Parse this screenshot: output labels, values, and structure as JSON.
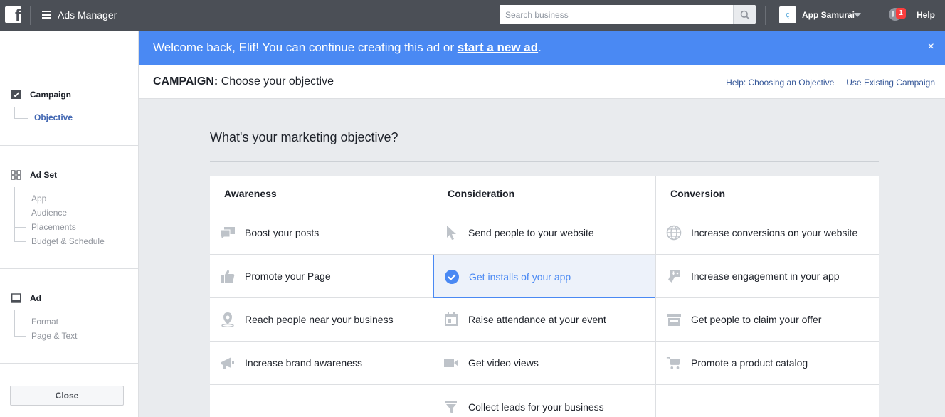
{
  "topbar": {
    "title": "Ads Manager",
    "search_placeholder": "Search business",
    "account_name": "App Samurai",
    "account_initial": "ç",
    "notification_count": "1",
    "help_label": "Help"
  },
  "banner": {
    "text_before": "Welcome back, Elif! You can continue creating this ad or ",
    "link": "start a new ad",
    "text_after": ".",
    "close": "×"
  },
  "campaign_header": {
    "label": "CAMPAIGN:",
    "title": " Choose your objective",
    "help_link": "Help: Choosing an Objective",
    "existing_link": "Use Existing Campaign"
  },
  "sidebar": {
    "campaign": {
      "label": "Campaign",
      "items": [
        "Objective"
      ]
    },
    "ad_set": {
      "label": "Ad Set",
      "items": [
        "App",
        "Audience",
        "Placements",
        "Budget & Schedule"
      ]
    },
    "ad": {
      "label": "Ad",
      "items": [
        "Format",
        "Page & Text"
      ]
    },
    "close_label": "Close"
  },
  "main": {
    "question": "What's your marketing objective?",
    "columns": [
      {
        "title": "Awareness",
        "items": [
          {
            "label": "Boost your posts",
            "icon": "speech-bubbles-icon"
          },
          {
            "label": "Promote your Page",
            "icon": "thumbs-up-icon"
          },
          {
            "label": "Reach people near your business",
            "icon": "map-pin-icon"
          },
          {
            "label": "Increase brand awareness",
            "icon": "megaphone-icon"
          }
        ]
      },
      {
        "title": "Consideration",
        "items": [
          {
            "label": "Send people to your website",
            "icon": "cursor-icon"
          },
          {
            "label": "Get installs of your app",
            "icon": "checkmark-icon",
            "selected": true
          },
          {
            "label": "Raise attendance at your event",
            "icon": "calendar-icon"
          },
          {
            "label": "Get video views",
            "icon": "video-camera-icon"
          },
          {
            "label": "Collect leads for your business",
            "icon": "funnel-icon"
          }
        ]
      },
      {
        "title": "Conversion",
        "items": [
          {
            "label": "Increase conversions on your website",
            "icon": "globe-icon"
          },
          {
            "label": "Increase engagement in your app",
            "icon": "gamepad-icon"
          },
          {
            "label": "Get people to claim your offer",
            "icon": "storefront-icon"
          },
          {
            "label": "Promote a product catalog",
            "icon": "shopping-cart-icon"
          }
        ]
      }
    ]
  },
  "colors": {
    "topbar": "#4b4f56",
    "banner": "#4a89f3",
    "accent": "#4a89f3",
    "link": "#365899",
    "icon_gray": "#bec3c9"
  }
}
